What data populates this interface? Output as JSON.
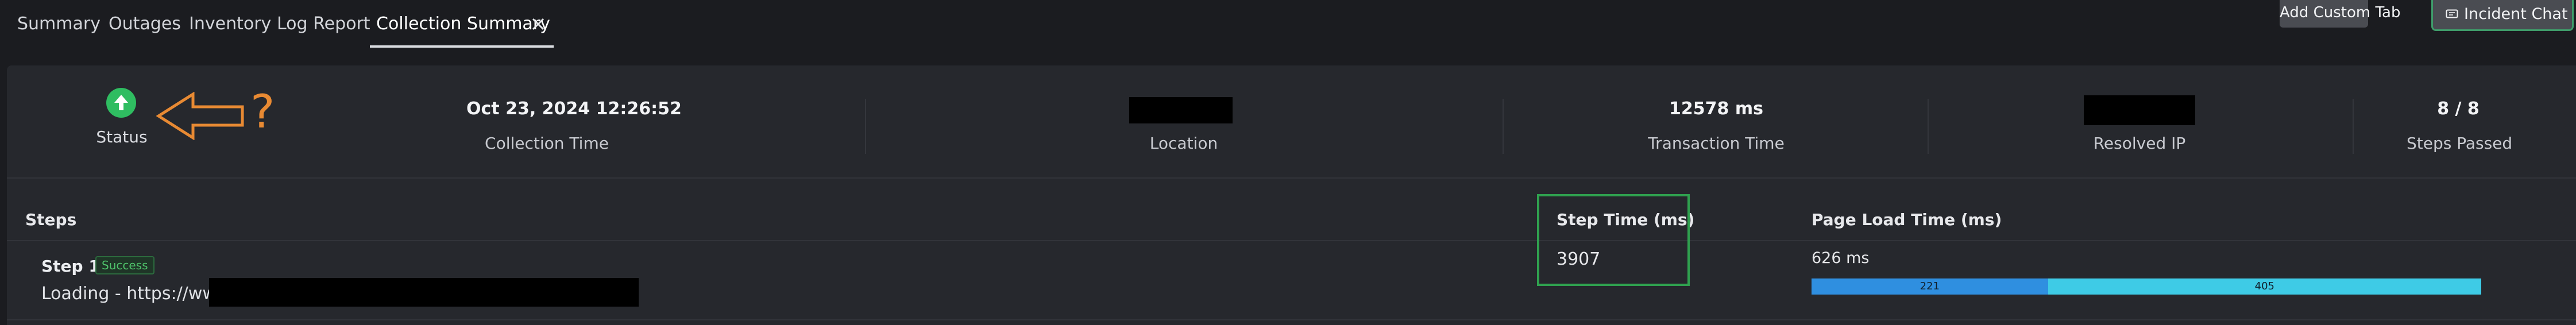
{
  "tabs": [
    {
      "label": "Summary"
    },
    {
      "label": "Outages"
    },
    {
      "label": "Inventory"
    },
    {
      "label": "Log Report"
    },
    {
      "label": "Collection Summary",
      "active": true
    }
  ],
  "toolbar": {
    "add_custom_tab": "Add Custom Tab",
    "incident_chat": "Incident Chat"
  },
  "summary": {
    "status": {
      "label": "Status",
      "icon": "arrow-up-circle-icon",
      "color": "#2fbd61"
    },
    "annotation": {
      "text": "?",
      "color": "#e88a33"
    },
    "collection_time": {
      "value": "Oct 23, 2024 12:26:52",
      "label": "Collection Time"
    },
    "location": {
      "label": "Location"
    },
    "transaction_time": {
      "value": "12578 ms",
      "label": "Transaction Time"
    },
    "resolved_ip": {
      "label": "Resolved IP"
    },
    "steps_passed": {
      "value": "8 / 8",
      "label": "Steps Passed"
    }
  },
  "steps_table": {
    "columns": {
      "steps": "Steps",
      "step_time": "Step Time (ms)",
      "page_load_time": "Page Load Time (ms)"
    },
    "rows": [
      {
        "name": "Step 1",
        "badge": "Success",
        "url": "Loading - https://www.",
        "step_time": "3907",
        "page_load_time": "626 ms",
        "breakdown": [
          {
            "value": 221,
            "color": "#2f8fe0"
          },
          {
            "value": 405,
            "color": "#3ecbe6"
          }
        ]
      }
    ]
  },
  "colors": {
    "highlight_box": "#2fa14f",
    "background": "#1b1c20",
    "panel": "#26282d"
  }
}
